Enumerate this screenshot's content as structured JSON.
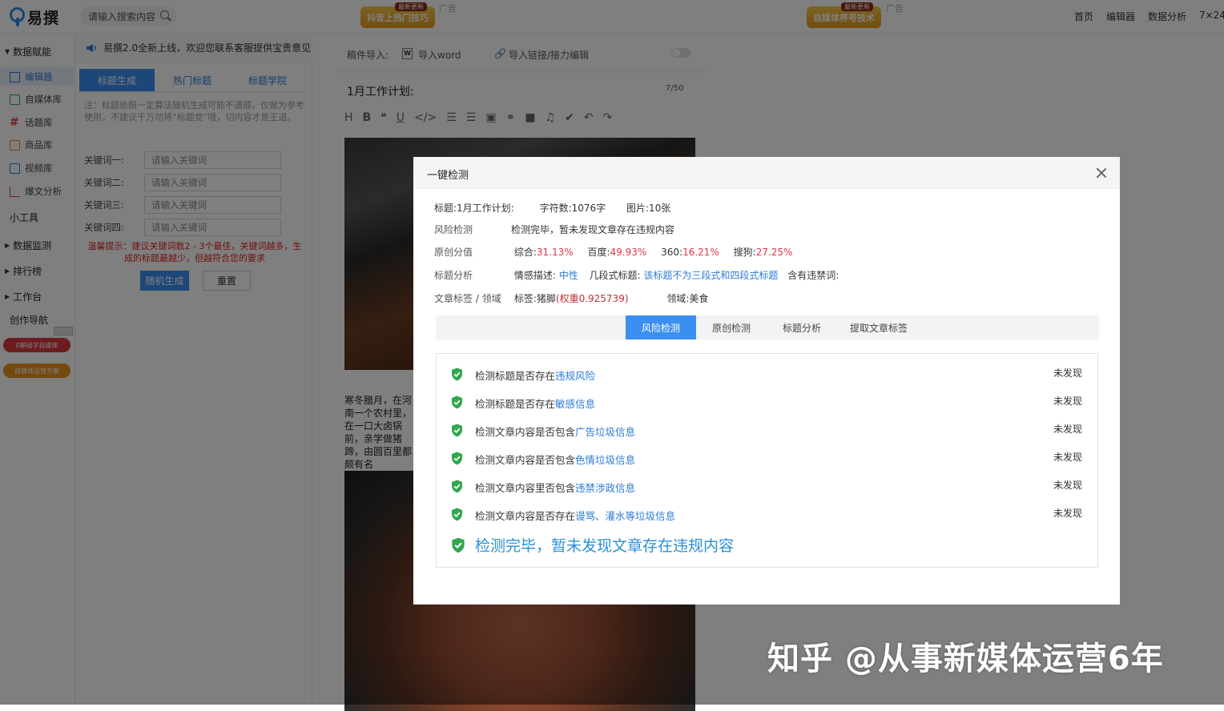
{
  "brand": {
    "name": "易撰"
  },
  "search": {
    "placeholder": "请输入搜索内容"
  },
  "ads": [
    {
      "text": "抖音上热门技巧",
      "tag": "最新更新",
      "label": "广告"
    },
    {
      "text": "自媒体养号技术",
      "tag": "最新更新",
      "label": "广告"
    }
  ],
  "nav": [
    "首页",
    "编辑器",
    "数据分析",
    "7×24"
  ],
  "sidebar": {
    "sections": [
      "数据赋能",
      "小工具",
      "数据监测",
      "排行榜",
      "工作台",
      "创作导航"
    ],
    "items": [
      "编辑器",
      "自媒体库",
      "话题库",
      "商品库",
      "视频库",
      "爆文分析"
    ],
    "pills": [
      "0基础学自媒体",
      "自媒体运营方案"
    ]
  },
  "notice": "易撰2.0全新上线，欢迎您联系客服提供宝贵意见",
  "title_tool": {
    "tabs": [
      "标题生成",
      "热门标题",
      "标题学院"
    ],
    "hint": "注：标题依照一定算法随机生成可能不通顺，仅做为参考使用，不建议千万勿将“标题党”哦，切内容才是王道。",
    "keywords": [
      {
        "label": "关键词一:",
        "placeholder": "请输入关键词"
      },
      {
        "label": "关键词二:",
        "placeholder": "请输入关键词"
      },
      {
        "label": "关键词三:",
        "placeholder": "请输入关键词"
      },
      {
        "label": "关键词四:",
        "placeholder": "请输入关键词"
      }
    ],
    "warning": "温馨提示：建议关键词数2 - 3个最佳，关键词越多，生成的标题最越少，但越符合您的要求",
    "generate_btn": "随机生成",
    "reset_btn": "重置"
  },
  "editor": {
    "import_label": "稿件导入:",
    "import_word": "导入word",
    "import_link": "导入链接/接力编辑",
    "title": "1月工作计划:",
    "counter": "7/50",
    "body_text": "寒冬腊月，在河南一个农村里，在一口大卤锅前，亲学做猪蹄，由圆百里都颇有名"
  },
  "modal": {
    "title": "一键检测",
    "title_line": {
      "title_label": "标题:",
      "title": "1月工作计划:",
      "chars_label": "字符数:",
      "chars": "1076字",
      "images_label": "图片:",
      "images": "10张"
    },
    "risk": {
      "label": "风险检测",
      "text": "检测完毕，暂未发现文章存在违规内容"
    },
    "original": {
      "label": "原创分值",
      "items": [
        {
          "name": "综合:",
          "value": "31.13%"
        },
        {
          "name": "百度:",
          "value": "49.93%"
        },
        {
          "name": "360:",
          "value": "16.21%"
        },
        {
          "name": "搜狗:",
          "value": "27.25%"
        }
      ]
    },
    "title_analysis": {
      "label": "标题分析",
      "emotion_label": "情感描述:",
      "emotion": "中性",
      "segments_label": "几段式标题:",
      "segments": "该标题不为三段式和四段式标题",
      "banned_label": "含有违禁词:"
    },
    "tags": {
      "label": "文章标签 / 领域",
      "tag_label": "标签:",
      "tag": "猪脚",
      "weight": "(权重0.925739)",
      "domain_label": "领域:",
      "domain": "美食"
    },
    "tabs": [
      "风险检测",
      "原创检测",
      "标题分析",
      "提取文章标签"
    ],
    "results": [
      {
        "prefix": "检测标题是否存在",
        "link": "违规风险",
        "status": "未发现"
      },
      {
        "prefix": "检测标题是否存在",
        "link": "敏感信息",
        "status": "未发现"
      },
      {
        "prefix": "检测文章内容是否包含",
        "link": "广告垃圾信息",
        "status": "未发现"
      },
      {
        "prefix": "检测文章内容是否包含",
        "link": "色情垃圾信息",
        "status": "未发现"
      },
      {
        "prefix": "检测文章内容里否包含",
        "link": "违禁涉政信息",
        "status": "未发现"
      },
      {
        "prefix": "检测文章内容是否存在",
        "link": "谩骂、灌水等垃圾信息",
        "status": "未发现"
      }
    ],
    "final": "检测完毕，暂未发现文章存在违规内容"
  },
  "watermark": "知乎 @从事新媒体运营6年",
  "colors": {
    "accent": "#3b8ff0",
    "link": "#2b7bd6",
    "score_red": "#e0334a",
    "shield_green": "#2fa84f"
  }
}
